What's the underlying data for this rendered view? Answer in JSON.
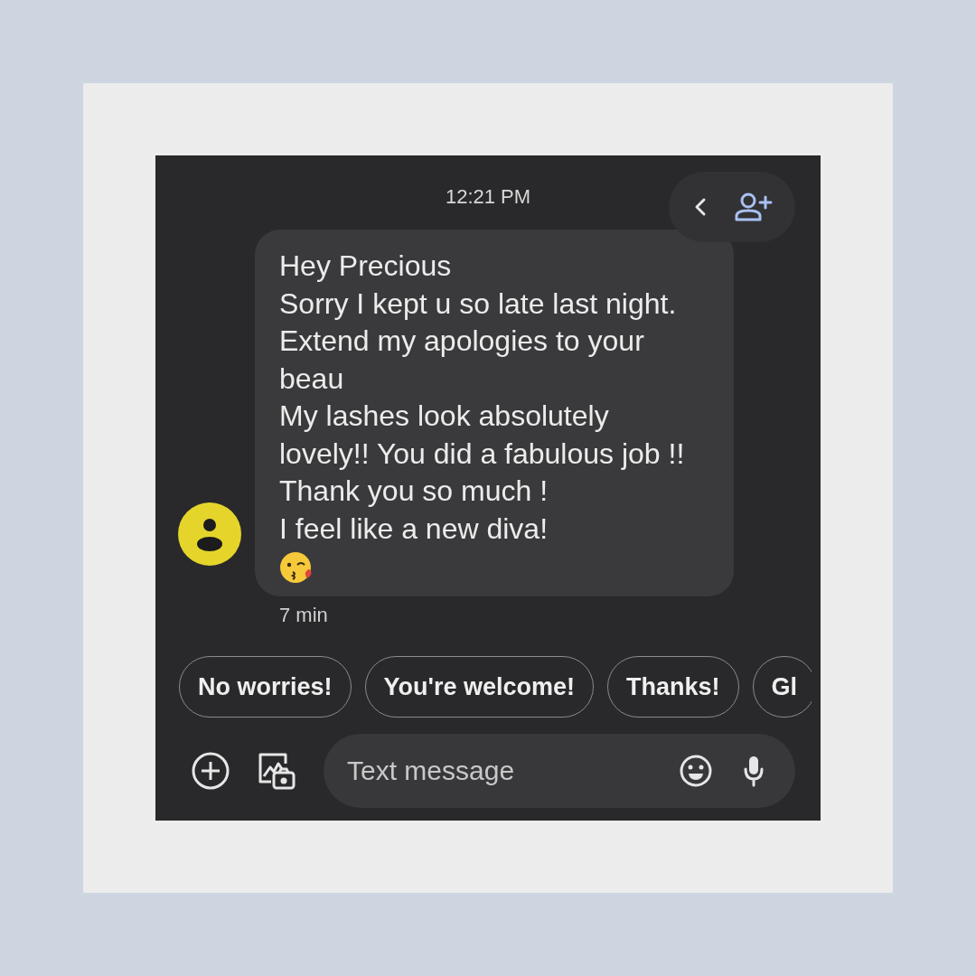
{
  "timestamp": "12:21 PM",
  "message": {
    "text": "Hey Precious\nSorry I kept u so late last night.\nExtend my apologies to your beau\nMy lashes look absolutely lovely!! You did a fabulous job !!\nThank you so much !\nI feel like a new diva!",
    "age": "7 min"
  },
  "smart_replies": [
    "No worries!",
    "You're welcome!",
    "Thanks!",
    "Gl"
  ],
  "compose": {
    "placeholder": "Text message"
  }
}
